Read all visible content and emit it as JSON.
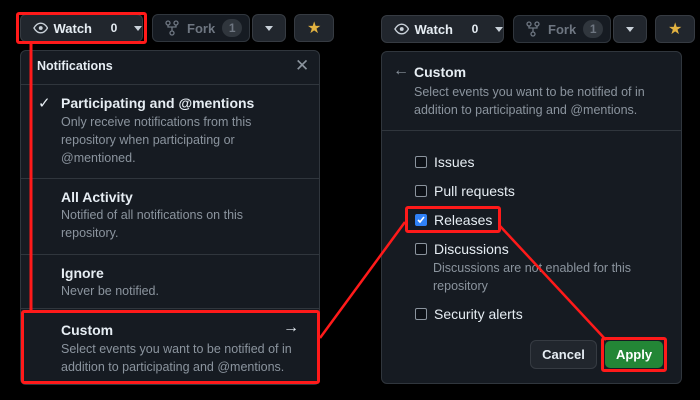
{
  "left": {
    "watch": {
      "label": "Watch",
      "count": "0"
    },
    "fork": {
      "label": "Fork",
      "count": "1"
    },
    "menu": {
      "title": "Notifications",
      "items": [
        {
          "title": "Participating and @mentions",
          "desc": "Only receive notifications from this repository when participating or @mentioned.",
          "checked": true
        },
        {
          "title": "All Activity",
          "desc": "Notified of all notifications on this repository."
        },
        {
          "title": "Ignore",
          "desc": "Never be notified."
        },
        {
          "title": "Custom",
          "desc": "Select events you want to be notified of in addition to participating and @mentions."
        }
      ]
    }
  },
  "right": {
    "watch": {
      "label": "Watch",
      "count": "0"
    },
    "fork": {
      "label": "Fork",
      "count": "1"
    },
    "panel": {
      "title": "Custom",
      "desc": "Select events you want to be notified of in addition to participating and @mentions.",
      "options": [
        {
          "label": "Issues",
          "checked": false
        },
        {
          "label": "Pull requests",
          "checked": false
        },
        {
          "label": "Releases",
          "checked": true
        },
        {
          "label": "Discussions",
          "checked": false,
          "note": "Discussions are not enabled for this repository"
        },
        {
          "label": "Security alerts",
          "checked": false
        }
      ],
      "cancel_label": "Cancel",
      "apply_label": "Apply"
    }
  },
  "colors": {
    "highlight": "#ff1a1a",
    "apply_green": "#238636",
    "check_blue": "#2f81f7"
  }
}
